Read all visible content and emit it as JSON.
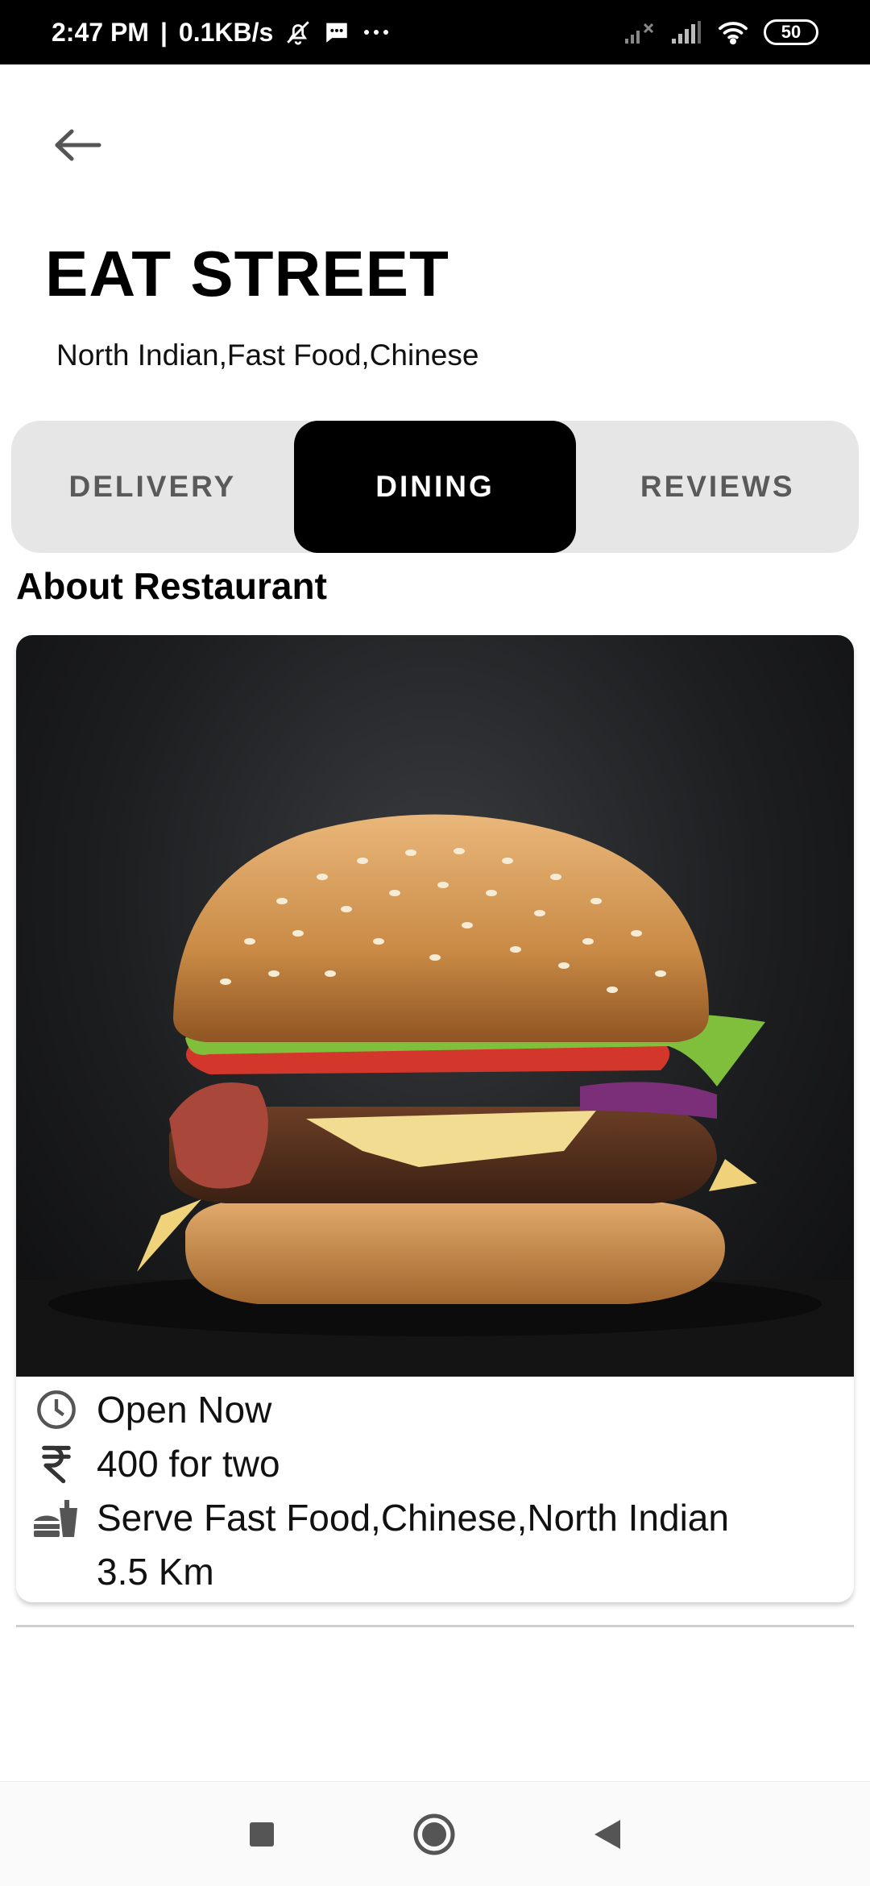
{
  "status_bar": {
    "time": "2:47 PM",
    "separator": "|",
    "speed": "0.1KB/s",
    "battery": "50",
    "icons": [
      "bell-off-icon",
      "message-icon",
      "more-icon",
      "signal-x-icon",
      "signal-icon",
      "wifi-icon",
      "battery-icon"
    ]
  },
  "header": {
    "back_icon": "arrow-left-icon",
    "title": "EAT STREET",
    "cuisines": "North Indian,Fast Food,Chinese"
  },
  "tabs": [
    {
      "label": "DELIVERY",
      "active": false
    },
    {
      "label": "DINING",
      "active": true
    },
    {
      "label": "REVIEWS",
      "active": false
    }
  ],
  "about": {
    "heading": "About Restaurant",
    "image": "burger-photo",
    "status": "Open Now",
    "cost": "400 for two",
    "serves": "Serve Fast Food,Chinese,North Indian",
    "distance": "3.5 Km"
  },
  "nav": {
    "icons": [
      "recents-square-icon",
      "home-circle-icon",
      "back-triangle-icon"
    ]
  },
  "colors": {
    "accent": "#000000",
    "tab_bg": "#e6e6e6",
    "tab_inactive_text": "#5a5a5a"
  }
}
